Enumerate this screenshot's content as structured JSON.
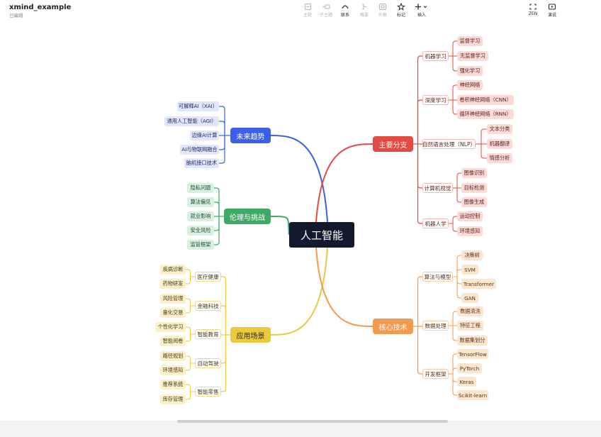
{
  "app": {
    "title": "xmind_example",
    "status": "已编辑"
  },
  "toolbar": {
    "topic": "主题",
    "subtopic": "子主题",
    "relationship": "联系",
    "summary": "概要",
    "boundary": "外框",
    "marker": "标记",
    "insert": "插入",
    "zen": "ZEN",
    "present": "演说"
  },
  "colors": {
    "blue": "#3d5ee8",
    "green": "#3faa66",
    "yellow": "#eac93a",
    "red": "#e24b43",
    "orange": "#f29a4d"
  },
  "map": {
    "root": "人工智能",
    "branches": [
      {
        "label": "未来趋势",
        "color": "blue",
        "children": [
          "可解释AI（XAI）",
          "通用人工智能（AGI）",
          "边缘AI计算",
          "AI与物联网融合",
          "脑机接口技术"
        ]
      },
      {
        "label": "伦理与挑战",
        "color": "green",
        "children": [
          "隐私问题",
          "算法偏见",
          "就业影响",
          "安全风险",
          "监管框架"
        ]
      },
      {
        "label": "应用场景",
        "color": "yellow",
        "groups": [
          {
            "label": "医疗健康",
            "children": [
              "疾病诊断",
              "药物研发"
            ]
          },
          {
            "label": "金融科技",
            "children": [
              "风险管理",
              "量化交易"
            ]
          },
          {
            "label": "智能教育",
            "children": [
              "个性化学习",
              "智能阅卷"
            ]
          },
          {
            "label": "自动驾驶",
            "children": [
              "路径规划",
              "环境感知"
            ]
          },
          {
            "label": "智能零售",
            "children": [
              "推荐系统",
              "库存管理"
            ]
          }
        ]
      },
      {
        "label": "主要分支",
        "color": "red",
        "groups": [
          {
            "label": "机器学习",
            "children": [
              "监督学习",
              "无监督学习",
              "强化学习"
            ]
          },
          {
            "label": "深度学习",
            "children": [
              "神经网络",
              "卷积神经网络（CNN）",
              "循环神经网络（RNN）"
            ]
          },
          {
            "label": "自然语言处理（NLP）",
            "children": [
              "文本分类",
              "机器翻译",
              "情感分析"
            ]
          },
          {
            "label": "计算机视觉",
            "children": [
              "图像识别",
              "目标检测",
              "图像生成"
            ]
          },
          {
            "label": "机器人学",
            "children": [
              "运动控制",
              "环境感知"
            ]
          }
        ]
      },
      {
        "label": "核心技术",
        "color": "orange",
        "groups": [
          {
            "label": "算法与模型",
            "children": [
              "决策树",
              "SVM",
              "Transformer",
              "GAN"
            ]
          },
          {
            "label": "数据处理",
            "children": [
              "数据清洗",
              "特征工程",
              "数据集划分"
            ]
          },
          {
            "label": "开发框架",
            "children": [
              "TensorFlow",
              "PyTorch",
              "Keras",
              "Scikit-learn"
            ]
          }
        ]
      }
    ]
  }
}
